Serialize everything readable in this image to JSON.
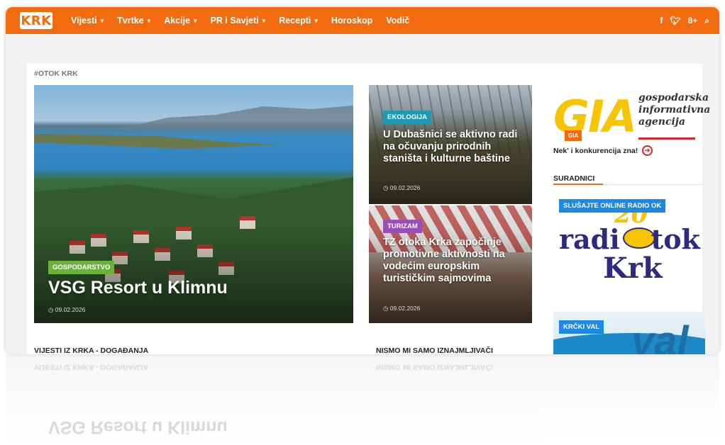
{
  "colors": {
    "brand": "#f26b0f",
    "badge_green": "#6ab23c",
    "badge_teal": "#1d9bb5",
    "badge_purple": "#9b4fb5",
    "badge_blue": "#1e88e5"
  },
  "header": {
    "logo": "KRK",
    "nav": [
      {
        "label": "Vijesti",
        "dropdown": true
      },
      {
        "label": "Tvrtke",
        "dropdown": true
      },
      {
        "label": "Akcije",
        "dropdown": true
      },
      {
        "label": "PR i Savjeti",
        "dropdown": true
      },
      {
        "label": "Recepti",
        "dropdown": true
      },
      {
        "label": "Horoskop",
        "dropdown": false
      },
      {
        "label": "Vodič",
        "dropdown": false
      }
    ],
    "social": [
      "f",
      "❖",
      "8+",
      "⌕"
    ]
  },
  "section_tag": "#OTOK KRK",
  "hero": {
    "category": "GOSPODARSTVO",
    "title": "VSG Resort u Klimnu",
    "date": "◷ 09.02.2026"
  },
  "cards": [
    {
      "category": "EKOLOGIJA",
      "title": "U Dubašnici se aktivno radi na očuvanju prirodnih staništa i kulturne baštine",
      "date": "◷ 09.02.2026"
    },
    {
      "category": "TURIZAM",
      "title": "TZ otoka Krka započinje promotivne aktivnosti na vodećim europskim turističkim sajmovima",
      "date": "◷ 09.02.2026"
    }
  ],
  "sections": {
    "left": "VIJESTI IZ KRKA - DOGAĐANJA",
    "right": "NISMO MI SAMO IZNAJMLJIVAČI"
  },
  "sidebar": {
    "gia_logo": "GIA",
    "gia_badge": "GIA",
    "gia_name": [
      "gospodarska",
      "informativna",
      "agencija"
    ],
    "gia_slogan": "Nek' i konkurencija zna!",
    "suradnici": "SURADNICI",
    "radio_badge": "SLUŠAJTE ONLINE RADIO OK",
    "radio_logo": [
      "radi",
      "tok",
      "Krk",
      "20"
    ],
    "val_badge": "KRČKI VAL",
    "val_logo": "val"
  }
}
